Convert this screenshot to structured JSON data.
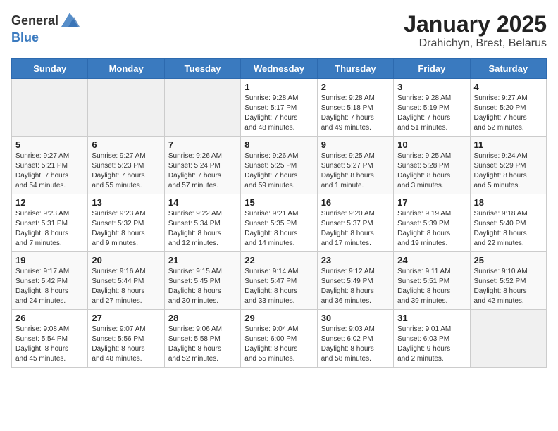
{
  "header": {
    "logo_general": "General",
    "logo_blue": "Blue",
    "title": "January 2025",
    "subtitle": "Drahichyn, Brest, Belarus"
  },
  "weekdays": [
    "Sunday",
    "Monday",
    "Tuesday",
    "Wednesday",
    "Thursday",
    "Friday",
    "Saturday"
  ],
  "weeks": [
    [
      {
        "day": "",
        "info": ""
      },
      {
        "day": "",
        "info": ""
      },
      {
        "day": "",
        "info": ""
      },
      {
        "day": "1",
        "info": "Sunrise: 9:28 AM\nSunset: 5:17 PM\nDaylight: 7 hours\nand 48 minutes."
      },
      {
        "day": "2",
        "info": "Sunrise: 9:28 AM\nSunset: 5:18 PM\nDaylight: 7 hours\nand 49 minutes."
      },
      {
        "day": "3",
        "info": "Sunrise: 9:28 AM\nSunset: 5:19 PM\nDaylight: 7 hours\nand 51 minutes."
      },
      {
        "day": "4",
        "info": "Sunrise: 9:27 AM\nSunset: 5:20 PM\nDaylight: 7 hours\nand 52 minutes."
      }
    ],
    [
      {
        "day": "5",
        "info": "Sunrise: 9:27 AM\nSunset: 5:21 PM\nDaylight: 7 hours\nand 54 minutes."
      },
      {
        "day": "6",
        "info": "Sunrise: 9:27 AM\nSunset: 5:23 PM\nDaylight: 7 hours\nand 55 minutes."
      },
      {
        "day": "7",
        "info": "Sunrise: 9:26 AM\nSunset: 5:24 PM\nDaylight: 7 hours\nand 57 minutes."
      },
      {
        "day": "8",
        "info": "Sunrise: 9:26 AM\nSunset: 5:25 PM\nDaylight: 7 hours\nand 59 minutes."
      },
      {
        "day": "9",
        "info": "Sunrise: 9:25 AM\nSunset: 5:27 PM\nDaylight: 8 hours\nand 1 minute."
      },
      {
        "day": "10",
        "info": "Sunrise: 9:25 AM\nSunset: 5:28 PM\nDaylight: 8 hours\nand 3 minutes."
      },
      {
        "day": "11",
        "info": "Sunrise: 9:24 AM\nSunset: 5:29 PM\nDaylight: 8 hours\nand 5 minutes."
      }
    ],
    [
      {
        "day": "12",
        "info": "Sunrise: 9:23 AM\nSunset: 5:31 PM\nDaylight: 8 hours\nand 7 minutes."
      },
      {
        "day": "13",
        "info": "Sunrise: 9:23 AM\nSunset: 5:32 PM\nDaylight: 8 hours\nand 9 minutes."
      },
      {
        "day": "14",
        "info": "Sunrise: 9:22 AM\nSunset: 5:34 PM\nDaylight: 8 hours\nand 12 minutes."
      },
      {
        "day": "15",
        "info": "Sunrise: 9:21 AM\nSunset: 5:35 PM\nDaylight: 8 hours\nand 14 minutes."
      },
      {
        "day": "16",
        "info": "Sunrise: 9:20 AM\nSunset: 5:37 PM\nDaylight: 8 hours\nand 17 minutes."
      },
      {
        "day": "17",
        "info": "Sunrise: 9:19 AM\nSunset: 5:39 PM\nDaylight: 8 hours\nand 19 minutes."
      },
      {
        "day": "18",
        "info": "Sunrise: 9:18 AM\nSunset: 5:40 PM\nDaylight: 8 hours\nand 22 minutes."
      }
    ],
    [
      {
        "day": "19",
        "info": "Sunrise: 9:17 AM\nSunset: 5:42 PM\nDaylight: 8 hours\nand 24 minutes."
      },
      {
        "day": "20",
        "info": "Sunrise: 9:16 AM\nSunset: 5:44 PM\nDaylight: 8 hours\nand 27 minutes."
      },
      {
        "day": "21",
        "info": "Sunrise: 9:15 AM\nSunset: 5:45 PM\nDaylight: 8 hours\nand 30 minutes."
      },
      {
        "day": "22",
        "info": "Sunrise: 9:14 AM\nSunset: 5:47 PM\nDaylight: 8 hours\nand 33 minutes."
      },
      {
        "day": "23",
        "info": "Sunrise: 9:12 AM\nSunset: 5:49 PM\nDaylight: 8 hours\nand 36 minutes."
      },
      {
        "day": "24",
        "info": "Sunrise: 9:11 AM\nSunset: 5:51 PM\nDaylight: 8 hours\nand 39 minutes."
      },
      {
        "day": "25",
        "info": "Sunrise: 9:10 AM\nSunset: 5:52 PM\nDaylight: 8 hours\nand 42 minutes."
      }
    ],
    [
      {
        "day": "26",
        "info": "Sunrise: 9:08 AM\nSunset: 5:54 PM\nDaylight: 8 hours\nand 45 minutes."
      },
      {
        "day": "27",
        "info": "Sunrise: 9:07 AM\nSunset: 5:56 PM\nDaylight: 8 hours\nand 48 minutes."
      },
      {
        "day": "28",
        "info": "Sunrise: 9:06 AM\nSunset: 5:58 PM\nDaylight: 8 hours\nand 52 minutes."
      },
      {
        "day": "29",
        "info": "Sunrise: 9:04 AM\nSunset: 6:00 PM\nDaylight: 8 hours\nand 55 minutes."
      },
      {
        "day": "30",
        "info": "Sunrise: 9:03 AM\nSunset: 6:02 PM\nDaylight: 8 hours\nand 58 minutes."
      },
      {
        "day": "31",
        "info": "Sunrise: 9:01 AM\nSunset: 6:03 PM\nDaylight: 9 hours\nand 2 minutes."
      },
      {
        "day": "",
        "info": ""
      }
    ]
  ]
}
